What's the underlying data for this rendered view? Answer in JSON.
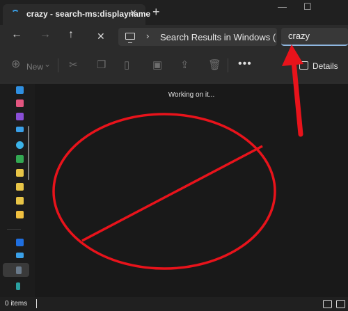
{
  "window": {
    "tab_title": "crazy - search-ms:displayname",
    "tab_close": "✕",
    "new_tab": "+",
    "minimize": "—",
    "maximize": "☐"
  },
  "nav": {
    "back": "←",
    "forward": "→",
    "up": "↑",
    "stop": "✕",
    "chevron": "›",
    "address": "Search Results in Windows (",
    "search_value": "crazy"
  },
  "toolbar": {
    "new_label": "New",
    "new_chevron": "⌄",
    "more": "•••",
    "details_label": "Details"
  },
  "content": {
    "status_message": "Working on it..."
  },
  "statusbar": {
    "item_count": "0 items"
  },
  "colors": {
    "annotation_red": "#e8131b",
    "accent_blue": "#3aa0e8"
  }
}
